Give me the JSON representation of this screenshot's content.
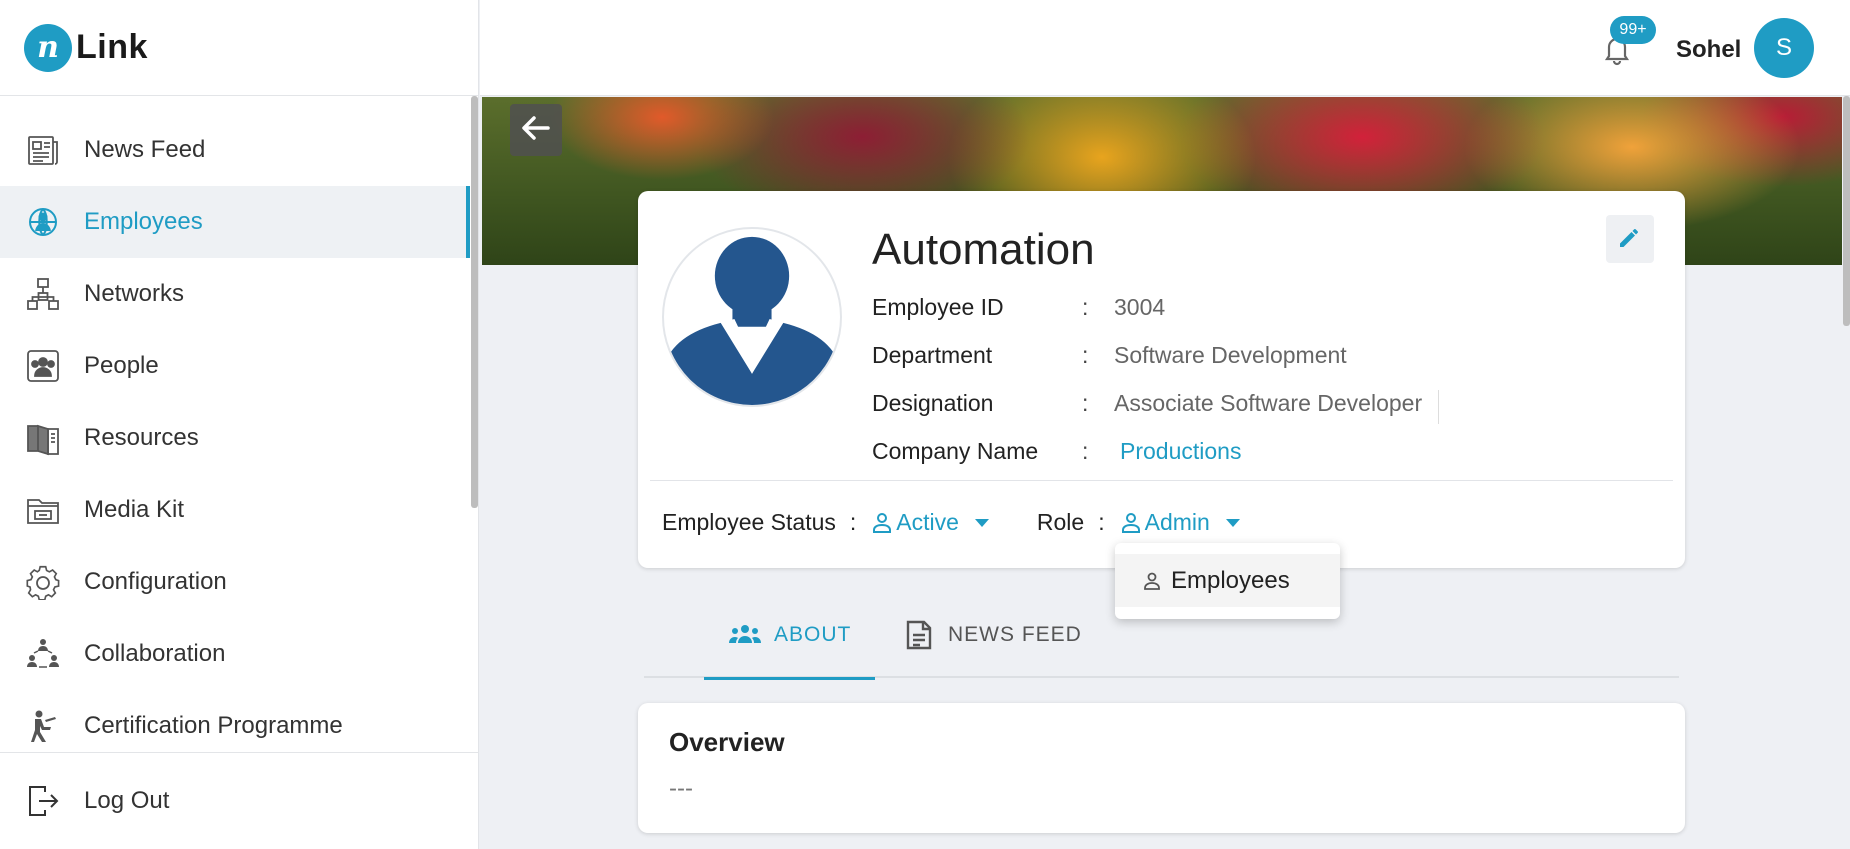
{
  "app": {
    "logo_mark": "n",
    "logo_text": "Link"
  },
  "sidebar": {
    "items": [
      {
        "label": "News Feed",
        "icon": "newspaper-icon"
      },
      {
        "label": "Employees",
        "icon": "employees-icon",
        "active": true
      },
      {
        "label": "Networks",
        "icon": "network-icon"
      },
      {
        "label": "People",
        "icon": "people-icon"
      },
      {
        "label": "Resources",
        "icon": "book-icon"
      },
      {
        "label": "Media Kit",
        "icon": "folder-icon"
      },
      {
        "label": "Configuration",
        "icon": "gear-icon"
      },
      {
        "label": "Collaboration",
        "icon": "collaboration-icon"
      },
      {
        "label": "Certification Programme",
        "icon": "reader-icon"
      }
    ],
    "logout_label": "Log Out"
  },
  "header": {
    "notification_count": "99+",
    "user_name": "Sohel",
    "user_initial": "S"
  },
  "profile": {
    "name": "Automation",
    "fields": {
      "employee_id": {
        "label": "Employee ID",
        "value": "3004"
      },
      "department": {
        "label": "Department",
        "value": "Software Development"
      },
      "designation": {
        "label": "Designation",
        "value": "Associate Software Developer"
      },
      "company": {
        "label": "Company Name",
        "value": "Productions"
      }
    },
    "colon": ":",
    "status": {
      "label": "Employee Status",
      "value": "Active"
    },
    "role": {
      "label": "Role",
      "value": "Admin"
    }
  },
  "role_menu": {
    "options": [
      "Employees"
    ]
  },
  "tabs": [
    {
      "label": "ABOUT",
      "active": true
    },
    {
      "label": "NEWS FEED"
    }
  ],
  "overview": {
    "title": "Overview",
    "body": "---"
  },
  "colors": {
    "accent": "#1f9cc4",
    "avatar_blue": "#24568e"
  }
}
